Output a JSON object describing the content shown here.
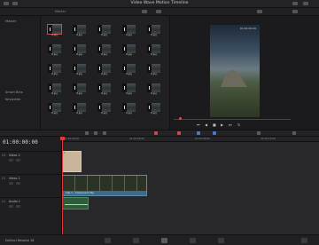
{
  "window": {
    "title": "Video Wave Motion Timeline"
  },
  "media_pool": {
    "header": "Master",
    "bins": [
      "Master",
      "Smart Bins",
      "Keywords"
    ],
    "clips": [
      "8.jpg",
      "8.jpg",
      "8.jpg",
      "8.jpg",
      "8.jpg",
      "8.jpg",
      "8.jpg",
      "8.jpg",
      "8.jpg",
      "8.jpg",
      "8.jpg",
      "8.jpg",
      "8.jpg",
      "8.jpg",
      "8.jpg",
      "8.jpg",
      "8.jpg",
      "8.jpg",
      "8.jpg",
      "8.jpg",
      "8.jpg",
      "8.jpg",
      "8.jpg",
      "8.jpg",
      "8.jpg"
    ]
  },
  "viewer": {
    "timecode": "01:00:00:00"
  },
  "timeline": {
    "timecode": "01:00:00:00",
    "ruler": [
      "01:00:00:00",
      "01:00:04:00",
      "01:00:08:00",
      "01:00:12:00",
      "01:00:16:00"
    ],
    "tracks": [
      {
        "id": "V2",
        "name": "Video 2"
      },
      {
        "id": "V1",
        "name": "Video 1"
      },
      {
        "id": "A1",
        "name": "Audio 1"
      }
    ],
    "clip_v1_label": "Clip 1 - Compound Clip"
  },
  "footer": {
    "app": "DaVinci Resolve 18"
  },
  "colors": {
    "playhead": "#e23a3a",
    "video_clip": "#3d6a8a",
    "audio_clip": "#2f5b3c",
    "title_clip": "#c9b69a"
  }
}
